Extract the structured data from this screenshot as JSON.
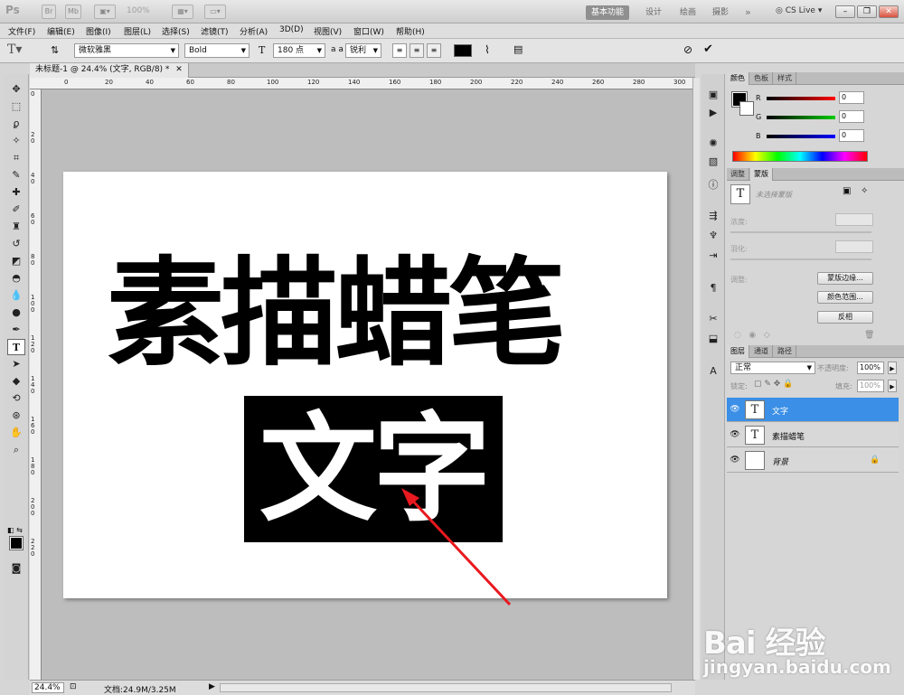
{
  "app": {
    "logo": "Ps",
    "zoom": "100%",
    "workspaces": [
      "基本功能",
      "设计",
      "绘画",
      "摄影"
    ],
    "more": "»",
    "cslive": "CS Live"
  },
  "menus": [
    "文件(F)",
    "编辑(E)",
    "图像(I)",
    "图层(L)",
    "选择(S)",
    "滤镜(T)",
    "分析(A)",
    "3D(D)",
    "视图(V)",
    "窗口(W)",
    "帮助(H)"
  ],
  "options": {
    "font_family": "微软雅黑",
    "font_style": "Bold",
    "font_size": "180 点",
    "aa_prefix": "a a",
    "antialias": "锐利",
    "color": "#000000"
  },
  "document": {
    "tab_title": "未标题-1 @ 24.4% (文字, RGB/8) *",
    "main_text": "素描蜡笔",
    "sub_text": "文字"
  },
  "ruler": {
    "top": [
      "0",
      "20",
      "40",
      "60",
      "80",
      "100",
      "120",
      "140",
      "160",
      "180",
      "200",
      "220",
      "240",
      "260",
      "280",
      "300"
    ],
    "left": [
      "0",
      "2 0",
      "4 0",
      "6 0",
      "8 0",
      "1 0 0",
      "1 2 0",
      "1 4 0",
      "1 6 0",
      "1 8 0",
      "2 0 0",
      "2 2 0"
    ]
  },
  "status": {
    "zoom": "24.4%",
    "doc_size": "文档:24.9M/3.25M"
  },
  "color_panel": {
    "tabs": [
      "颜色",
      "色板",
      "样式"
    ],
    "r_label": "R",
    "g_label": "G",
    "b_label": "B",
    "r": "0",
    "g": "0",
    "b": "0"
  },
  "mask_panel": {
    "tabs": [
      "调整",
      "蒙版"
    ],
    "no_selection": "未选择蒙版",
    "density": "浓度:",
    "feather": "羽化:",
    "refine": "调整:",
    "btn_edge": "蒙版边缘...",
    "btn_range": "颜色范围...",
    "btn_invert": "反相"
  },
  "layers_panel": {
    "tabs": [
      "图层",
      "通道",
      "路径"
    ],
    "blend_mode": "正常",
    "opacity_label": "不透明度:",
    "opacity": "100%",
    "lock_label": "锁定:",
    "fill_label": "填充:",
    "fill": "100%",
    "layers": [
      {
        "name": "文字",
        "type": "T",
        "selected": true
      },
      {
        "name": "素描蜡笔",
        "type": "T",
        "selected": false
      },
      {
        "name": "背景",
        "type": "",
        "selected": false
      }
    ]
  },
  "watermark": {
    "logo": "Bai 经验",
    "url": "jingyan.baidu.com"
  },
  "colors": {
    "accent": "#3b8fe6",
    "arrow": "#e8191f"
  }
}
